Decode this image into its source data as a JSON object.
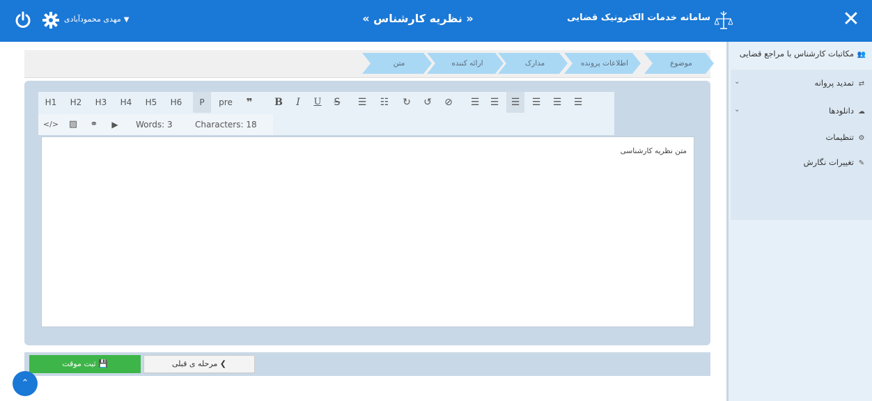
{
  "header": {
    "brand": "سامانه خدمات الکترونیک قضایی",
    "page_title": "« نظریه کارشناس »",
    "user_name": "مهدی محمودآبادی"
  },
  "sidebar": {
    "items": [
      {
        "label": "مکاتبات کارشناس با مراجع قضایی",
        "icon": "users-icon",
        "has_submenu": false
      },
      {
        "label": "تمدید پروانه",
        "icon": "retweet-icon",
        "has_submenu": true
      },
      {
        "label": "دانلودها",
        "icon": "cloud-download-icon",
        "has_submenu": true
      },
      {
        "label": "تنظیمات",
        "icon": "gear-icon",
        "has_submenu": false
      },
      {
        "label": "تغییرات نگارش",
        "icon": "pencil-icon",
        "has_submenu": false
      }
    ]
  },
  "steps": [
    {
      "label": "موضوع"
    },
    {
      "label": "اطلاعات پرونده"
    },
    {
      "label": "مدارک"
    },
    {
      "label": "ارائه کننده"
    },
    {
      "label": "متن"
    }
  ],
  "toolbar": {
    "headings": [
      "H1",
      "H2",
      "H3",
      "H4",
      "H5",
      "H6",
      "P",
      "pre"
    ],
    "active_format": "P",
    "words_label": "Words: 3",
    "characters_label": "Characters: 18"
  },
  "editor": {
    "content": "متن نظریه کارشناسی"
  },
  "buttons": {
    "save_label": "ثبت موقت",
    "prev_label": "مرحله ی قبلی"
  },
  "colors": {
    "header": "#1a78d6",
    "sidebar": "#e6f0f8",
    "step": "#a9d8f5",
    "save": "#3db548"
  }
}
